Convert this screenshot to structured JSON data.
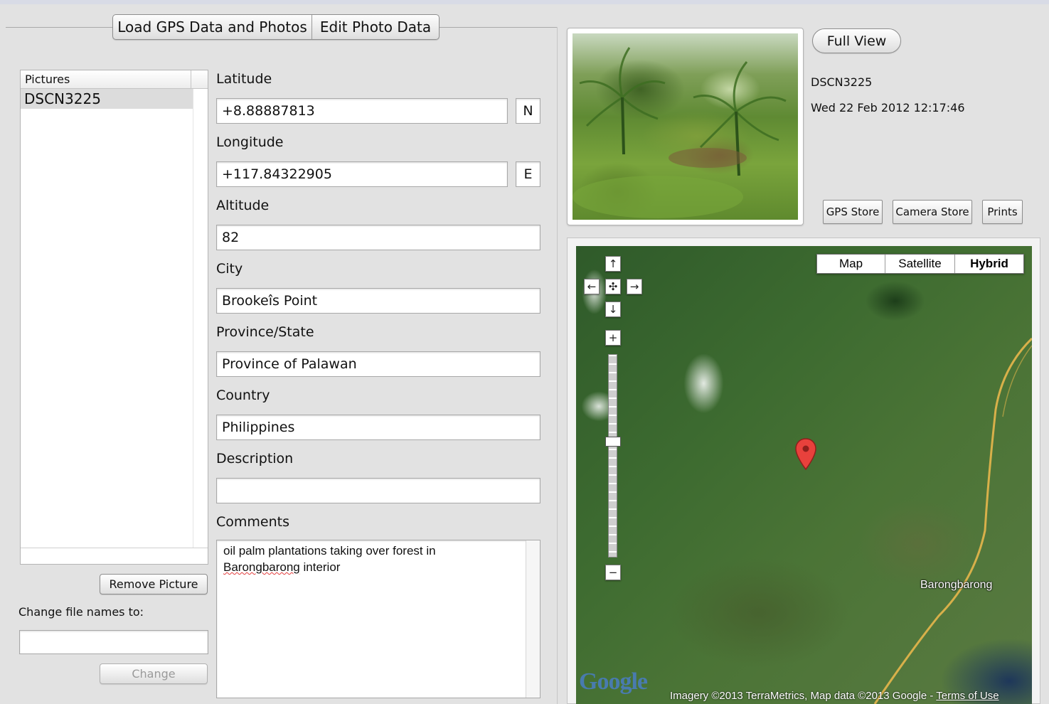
{
  "tabs": {
    "load": "Load GPS Data and Photos",
    "edit": "Edit Photo Data"
  },
  "pictures": {
    "header": "Pictures",
    "items": [
      "DSCN3225"
    ],
    "remove_label": "Remove Picture",
    "change_label": "Change file names to:",
    "rename_value": "",
    "change_button": "Change"
  },
  "form": {
    "latitude": {
      "label": "Latitude",
      "value": "+8.88887813",
      "hemisphere": "N"
    },
    "longitude": {
      "label": "Longitude",
      "value": "+117.84322905",
      "hemisphere": "E"
    },
    "altitude": {
      "label": "Altitude",
      "value": "82"
    },
    "city": {
      "label": "City",
      "value": "Brookeîs Point"
    },
    "province": {
      "label": "Province/State",
      "value": "Province of Palawan"
    },
    "country": {
      "label": "Country",
      "value": "Philippines"
    },
    "description": {
      "label": "Description",
      "value": ""
    },
    "comments": {
      "label": "Comments",
      "line1": "oil palm plantations taking over forest in",
      "word_misspelled": "Barongbarong",
      "line2_rest": " interior"
    }
  },
  "photo": {
    "full_view": "Full View",
    "filename": "DSCN3225",
    "date": "Wed 22 Feb 2012 12:17:46",
    "gps_store": "GPS Store",
    "camera_store": "Camera Store",
    "prints": "Prints"
  },
  "map": {
    "types": [
      "Map",
      "Satellite",
      "Hybrid"
    ],
    "selected_type": "Hybrid",
    "place_label": "Barongbarong",
    "logo": "Google",
    "attribution": "Imagery ©2013 TerraMetrics, Map data ©2013 Google - ",
    "terms": "Terms of Use",
    "controls": {
      "up": "↑",
      "down": "↓",
      "left": "←",
      "right": "→",
      "center": "✣",
      "zoom_in": "+",
      "zoom_out": "−"
    }
  },
  "colors": {
    "window_bg": "#e2e2e2",
    "pin": "#e8413c",
    "road": "#d8b04a",
    "selected_row": "#dcdcdc"
  }
}
